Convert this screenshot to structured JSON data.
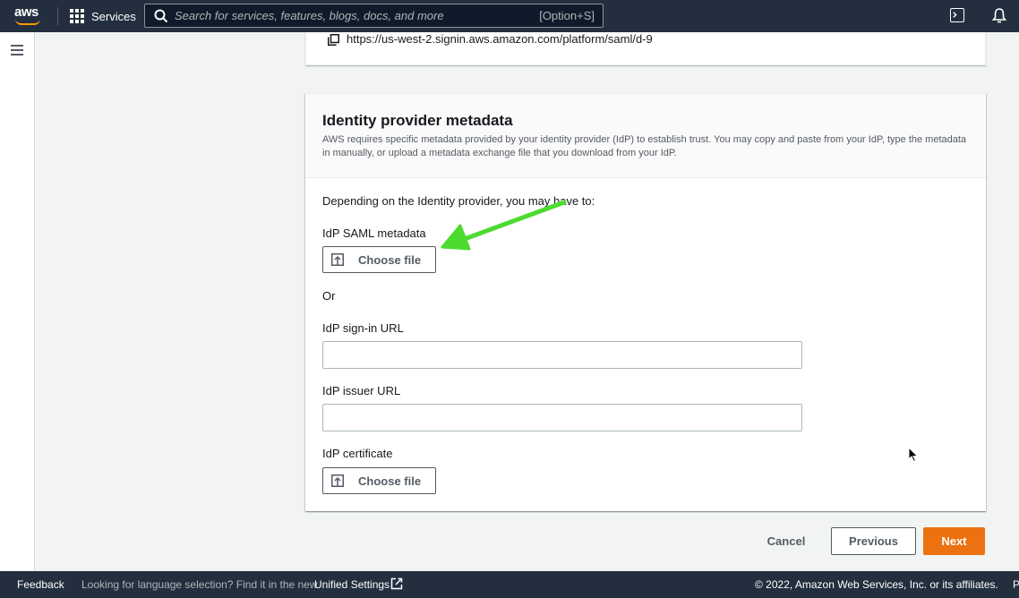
{
  "topnav": {
    "logo_text": "aws",
    "services_label": "Services",
    "search_placeholder": "Search for services, features, blogs, docs, and more",
    "search_shortcut": "[Option+S]"
  },
  "url_card": {
    "url": "https://us-west-2.signin.aws.amazon.com/platform/saml/d-9"
  },
  "metadata_card": {
    "title": "Identity provider metadata",
    "description": "AWS requires specific metadata provided by your identity provider (IdP) to establish trust. You may copy and paste from your IdP, type the metadata in manually, or upload a metadata exchange file that you download from your IdP.",
    "intro": "Depending on the Identity provider, you may have to:",
    "saml_label": "IdP SAML metadata",
    "choose_file_label": "Choose file",
    "or_text": "Or",
    "signin_url_label": "IdP sign-in URL",
    "signin_url_value": "",
    "issuer_url_label": "IdP issuer URL",
    "issuer_url_value": "",
    "certificate_label": "IdP certificate",
    "certificate_button_label": "Choose file"
  },
  "actions": {
    "cancel": "Cancel",
    "previous": "Previous",
    "next": "Next"
  },
  "footer": {
    "feedback": "Feedback",
    "language_text": "Looking for language selection? Find it in the new",
    "settings_link": "Unified Settings",
    "copyright": "© 2022, Amazon Web Services, Inc. or its affiliates.",
    "trailing": "P"
  },
  "colors": {
    "nav_bg": "#232f3e",
    "primary_button": "#ec7211",
    "annotation_arrow": "#4cdb2f"
  }
}
